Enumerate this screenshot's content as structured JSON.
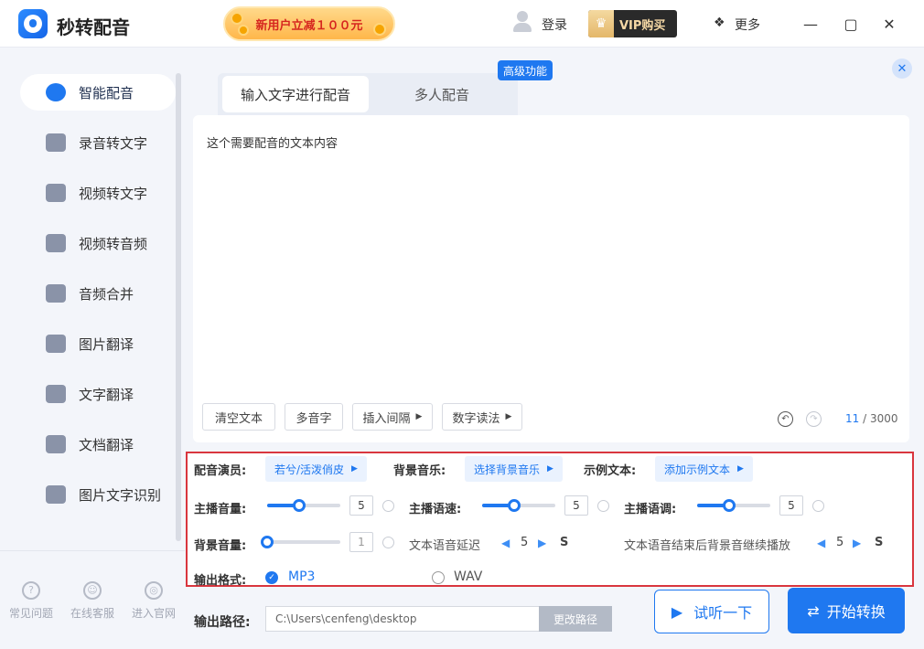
{
  "app": {
    "title": "秒转配音",
    "promo": "新用户立减１００元",
    "login": "登录",
    "vip": "VIP购买",
    "more": "更多"
  },
  "sidebar": {
    "items": [
      {
        "label": "智能配音",
        "icon": "mic-icon"
      },
      {
        "label": "录音转文字",
        "icon": "aa-icon"
      },
      {
        "label": "视频转文字",
        "icon": "video-icon"
      },
      {
        "label": "视频转音频",
        "icon": "wave-icon"
      },
      {
        "label": "音频合并",
        "icon": "merge-icon"
      },
      {
        "label": "图片翻译",
        "icon": "image-translate-icon"
      },
      {
        "label": "文字翻译",
        "icon": "text-translate-icon"
      },
      {
        "label": "文档翻译",
        "icon": "doc-translate-icon"
      },
      {
        "label": "图片文字识别",
        "icon": "ocr-icon"
      }
    ],
    "footer": [
      {
        "label": "常见问题",
        "glyph": "?"
      },
      {
        "label": "在线客服",
        "glyph": "☺"
      },
      {
        "label": "进入官网",
        "glyph": "◎"
      }
    ]
  },
  "tabs": {
    "tab1": "输入文字进行配音",
    "tab2": "多人配音",
    "badge": "高级功能"
  },
  "editor": {
    "text": "这个需要配音的文本内容",
    "count": "11",
    "max": "/ 3000"
  },
  "tools": {
    "clear": "清空文本",
    "poly": "多音字",
    "interval": "插入间隔",
    "number": "数字读法"
  },
  "settings": {
    "voice_label": "配音演员:",
    "voice_value": "若兮/活泼俏皮",
    "bgm_label": "背景音乐:",
    "bgm_value": "选择背景音乐",
    "sample_label": "示例文本:",
    "sample_value": "添加示例文本",
    "vol_label": "主播音量:",
    "vol_value": "5",
    "speed_label": "主播语速:",
    "speed_value": "5",
    "pitch_label": "主播语调:",
    "pitch_value": "5",
    "bgvol_label": "背景音量:",
    "bgvol_value": "1",
    "delay_label": "文本语音延迟",
    "delay_value": "5",
    "cont_label": "文本语音结束后背景音继续播放",
    "cont_value": "5",
    "unit": "S",
    "format_label": "输出格式:",
    "mp3": "MP3",
    "wav": "WAV"
  },
  "output": {
    "label": "输出路径:",
    "path": "C:\\Users\\cenfeng\\desktop",
    "change": "更改路径",
    "listen": "试听一下",
    "start": "开始转换"
  },
  "sliders": {
    "vol": 0.44,
    "speed": 0.44,
    "pitch": 0.44,
    "bgvol": 0.0
  },
  "colors": {
    "accent": "#1f78f0",
    "highlight_border": "#d9363e"
  }
}
